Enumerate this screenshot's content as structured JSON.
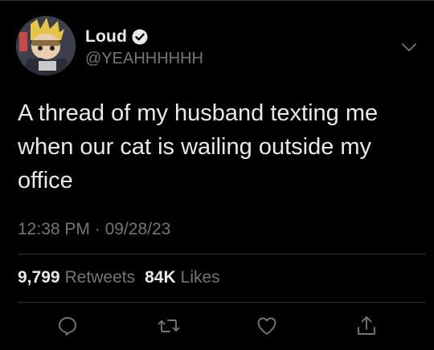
{
  "user": {
    "display_name": "Loud",
    "handle": "@YEAHHHHHH",
    "verified": true
  },
  "tweet": {
    "text": "A thread of my husband texting me\nwhen our cat is wailing outside my\noffice",
    "time": "12:38 PM",
    "separator": "·",
    "date": "09/28/23"
  },
  "stats": {
    "retweets_count": "9,799",
    "retweets_label": "Retweets",
    "likes_count": "84K",
    "likes_label": "Likes"
  },
  "actions": [
    "reply-icon",
    "retweet-icon",
    "like-icon",
    "share-icon"
  ],
  "colors": {
    "background": "#000000",
    "text_primary": "#e7e9ea",
    "text_secondary": "#71767b",
    "divider": "#2f3336"
  }
}
